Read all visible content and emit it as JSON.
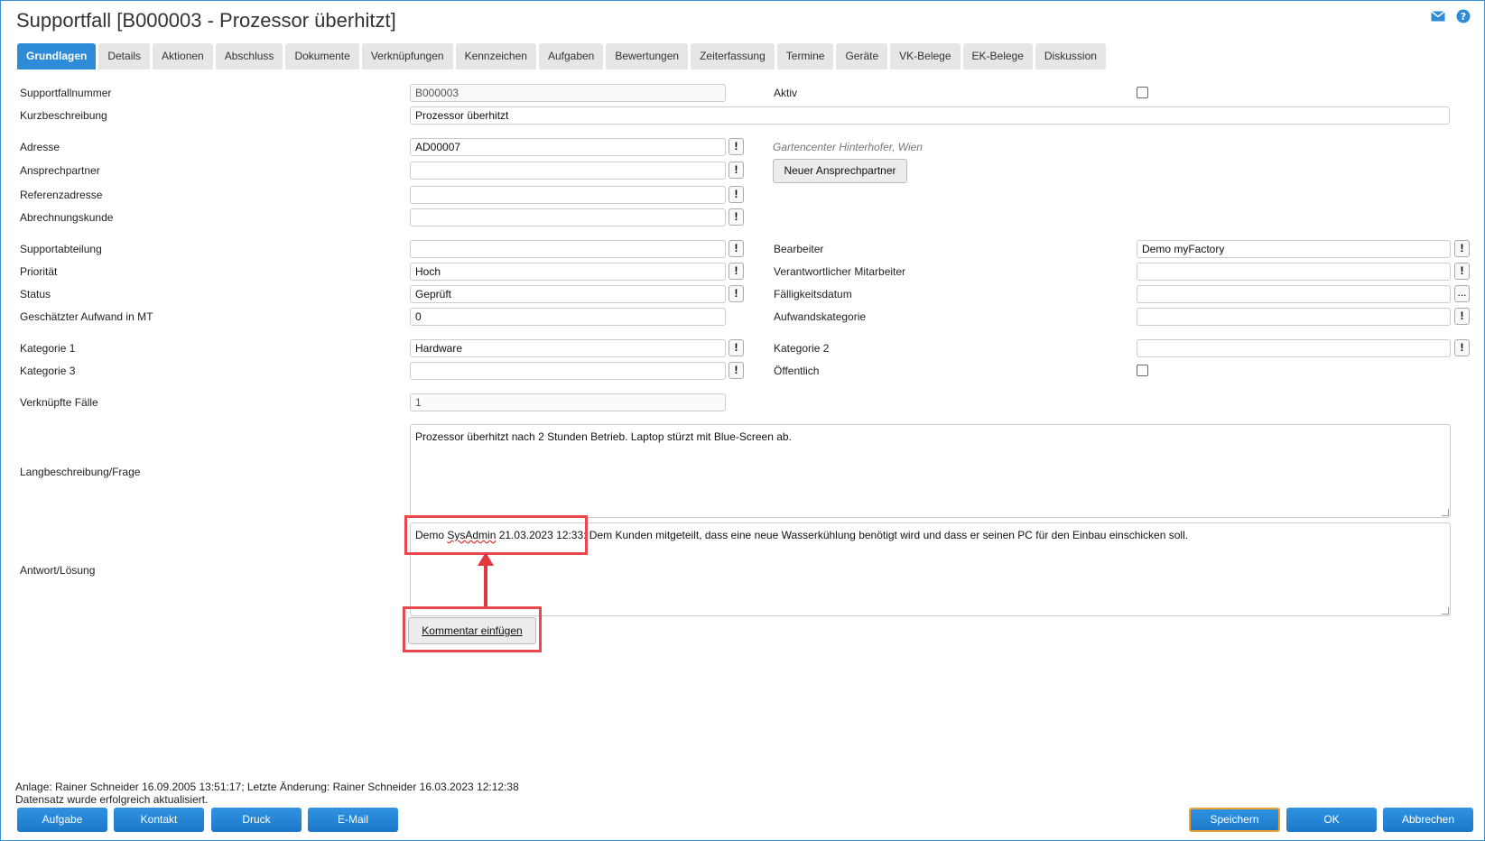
{
  "window": {
    "title": "Supportfall [B000003 - Prozessor überhitzt]"
  },
  "icons": {
    "mail": "mail-icon",
    "help": "help-icon"
  },
  "tabs": [
    "Grundlagen",
    "Details",
    "Aktionen",
    "Abschluss",
    "Dokumente",
    "Verknüpfungen",
    "Kennzeichen",
    "Aufgaben",
    "Bewertungen",
    "Zeiterfassung",
    "Termine",
    "Geräte",
    "VK-Belege",
    "EK-Belege",
    "Diskussion"
  ],
  "fields": {
    "supportfallnummer": {
      "label": "Supportfallnummer",
      "value": "B000003"
    },
    "aktiv": {
      "label": "Aktiv",
      "checked": false
    },
    "kurzbeschreibung": {
      "label": "Kurzbeschreibung",
      "value": "Prozessor überhitzt"
    },
    "adresse": {
      "label": "Adresse",
      "value": "AD00007",
      "hint": "Gartencenter Hinterhofer, Wien"
    },
    "ansprechpartner": {
      "label": "Ansprechpartner",
      "value": "",
      "button": "Neuer Ansprechpartner"
    },
    "referenzadresse": {
      "label": "Referenzadresse",
      "value": ""
    },
    "abrechnungskunde": {
      "label": "Abrechnungskunde",
      "value": ""
    },
    "supportabteilung": {
      "label": "Supportabteilung",
      "value": ""
    },
    "bearbeiter": {
      "label": "Bearbeiter",
      "value": "Demo myFactory"
    },
    "prioritaet": {
      "label": "Priorität",
      "value": "Hoch"
    },
    "verantwortlicher": {
      "label": "Verantwortlicher Mitarbeiter",
      "value": ""
    },
    "status": {
      "label": "Status",
      "value": "Geprüft"
    },
    "faelligkeitsdatum": {
      "label": "Fälligkeitsdatum",
      "value": ""
    },
    "aufwand": {
      "label": "Geschätzter Aufwand in MT",
      "value": "0"
    },
    "aufwandskategorie": {
      "label": "Aufwandskategorie",
      "value": ""
    },
    "kategorie1": {
      "label": "Kategorie 1",
      "value": "Hardware"
    },
    "kategorie2": {
      "label": "Kategorie 2",
      "value": ""
    },
    "kategorie3": {
      "label": "Kategorie 3",
      "value": ""
    },
    "oeffentlich": {
      "label": "Öffentlich",
      "checked": false
    },
    "verknuepfte": {
      "label": "Verknüpfte Fälle",
      "value": "1"
    },
    "langbeschreibung": {
      "label": "Langbeschreibung/Frage",
      "value": "Prozessor überhitzt nach 2 Stunden Betrieb. Laptop stürzt mit Blue-Screen ab."
    },
    "antwort": {
      "label": "Antwort/Lösung",
      "prefix": "Demo ",
      "user": "SysAdmin",
      "stamp": " 21.03.2023 12:33:",
      "text": " Dem Kunden mitgeteilt, dass eine neue Wasserkühlung benötigt wird und dass er seinen PC für den Einbau einschicken soll."
    }
  },
  "comment_button": "Kommentar einfügen",
  "excl_glyph": "!",
  "dots_glyph": "...",
  "status": {
    "line1": "Anlage: Rainer Schneider 16.09.2005 13:51:17; Letzte Änderung: Rainer Schneider 16.03.2023 12:12:38",
    "line2": "Datensatz wurde erfolgreich aktualisiert."
  },
  "bottom_buttons": {
    "left": [
      "Aufgabe",
      "Kontakt",
      "Druck",
      "E-Mail"
    ],
    "right": [
      "Speichern",
      "OK",
      "Abbrechen"
    ]
  }
}
